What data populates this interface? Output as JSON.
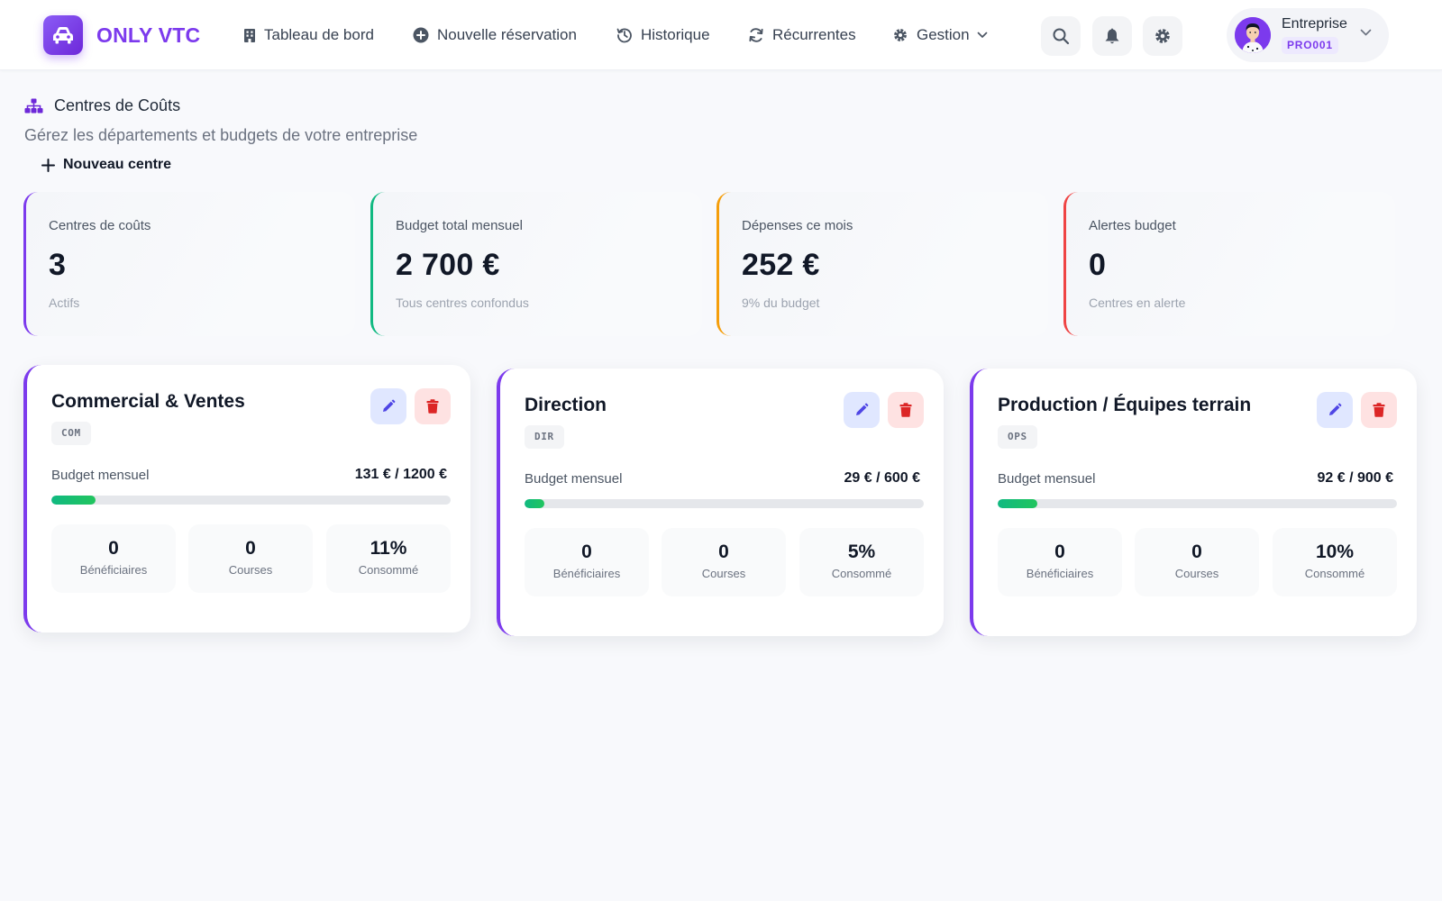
{
  "brand": {
    "name": "ONLY VTC"
  },
  "nav": [
    {
      "label": "Tableau de bord",
      "icon": "building-icon"
    },
    {
      "label": "Nouvelle réservation",
      "icon": "plus-circle-icon"
    },
    {
      "label": "Historique",
      "icon": "history-icon"
    },
    {
      "label": "Récurrentes",
      "icon": "sync-icon"
    },
    {
      "label": "Gestion",
      "icon": "gear-icon"
    }
  ],
  "user": {
    "name": "Entreprise",
    "code": "PRO001"
  },
  "page": {
    "title": "Centres de Coûts",
    "subtitle": "Gérez les départements et budgets de votre entreprise",
    "new_button": "Nouveau centre"
  },
  "stats": [
    {
      "label": "Centres de coûts",
      "value": "3",
      "note": "Actifs",
      "color": "#7c3aed"
    },
    {
      "label": "Budget total mensuel",
      "value": "2 700 €",
      "note": "Tous centres confondus",
      "color": "#10b981"
    },
    {
      "label": "Dépenses ce mois",
      "value": "252 €",
      "note": "9% du budget",
      "color": "#f59e0b"
    },
    {
      "label": "Alertes budget",
      "value": "0",
      "note": "Centres en alerte",
      "color": "#ef4444"
    }
  ],
  "centers": [
    {
      "name": "Commercial & Ventes",
      "code": "COM",
      "budget_label": "Budget mensuel",
      "budget_value": "131 € / 1200 €",
      "progress": 0.11,
      "metrics": [
        {
          "value": "0",
          "label": "Bénéficiaires"
        },
        {
          "value": "0",
          "label": "Courses"
        },
        {
          "value": "11%",
          "label": "Consommé"
        }
      ]
    },
    {
      "name": "Direction",
      "code": "DIR",
      "budget_label": "Budget mensuel",
      "budget_value": "29 € / 600 €",
      "progress": 0.05,
      "metrics": [
        {
          "value": "0",
          "label": "Bénéficiaires"
        },
        {
          "value": "0",
          "label": "Courses"
        },
        {
          "value": "5%",
          "label": "Consommé"
        }
      ]
    },
    {
      "name": "Production / Équipes terrain",
      "code": "OPS",
      "budget_label": "Budget mensuel",
      "budget_value": "92 € / 900 €",
      "progress": 0.1,
      "metrics": [
        {
          "value": "0",
          "label": "Bénéficiaires"
        },
        {
          "value": "0",
          "label": "Courses"
        },
        {
          "value": "10%",
          "label": "Consommé"
        }
      ]
    }
  ],
  "colors": {
    "brand": "#7c3aed",
    "edit": "#4f46e5",
    "delete": "#dc2626",
    "progress": "#10b981"
  }
}
